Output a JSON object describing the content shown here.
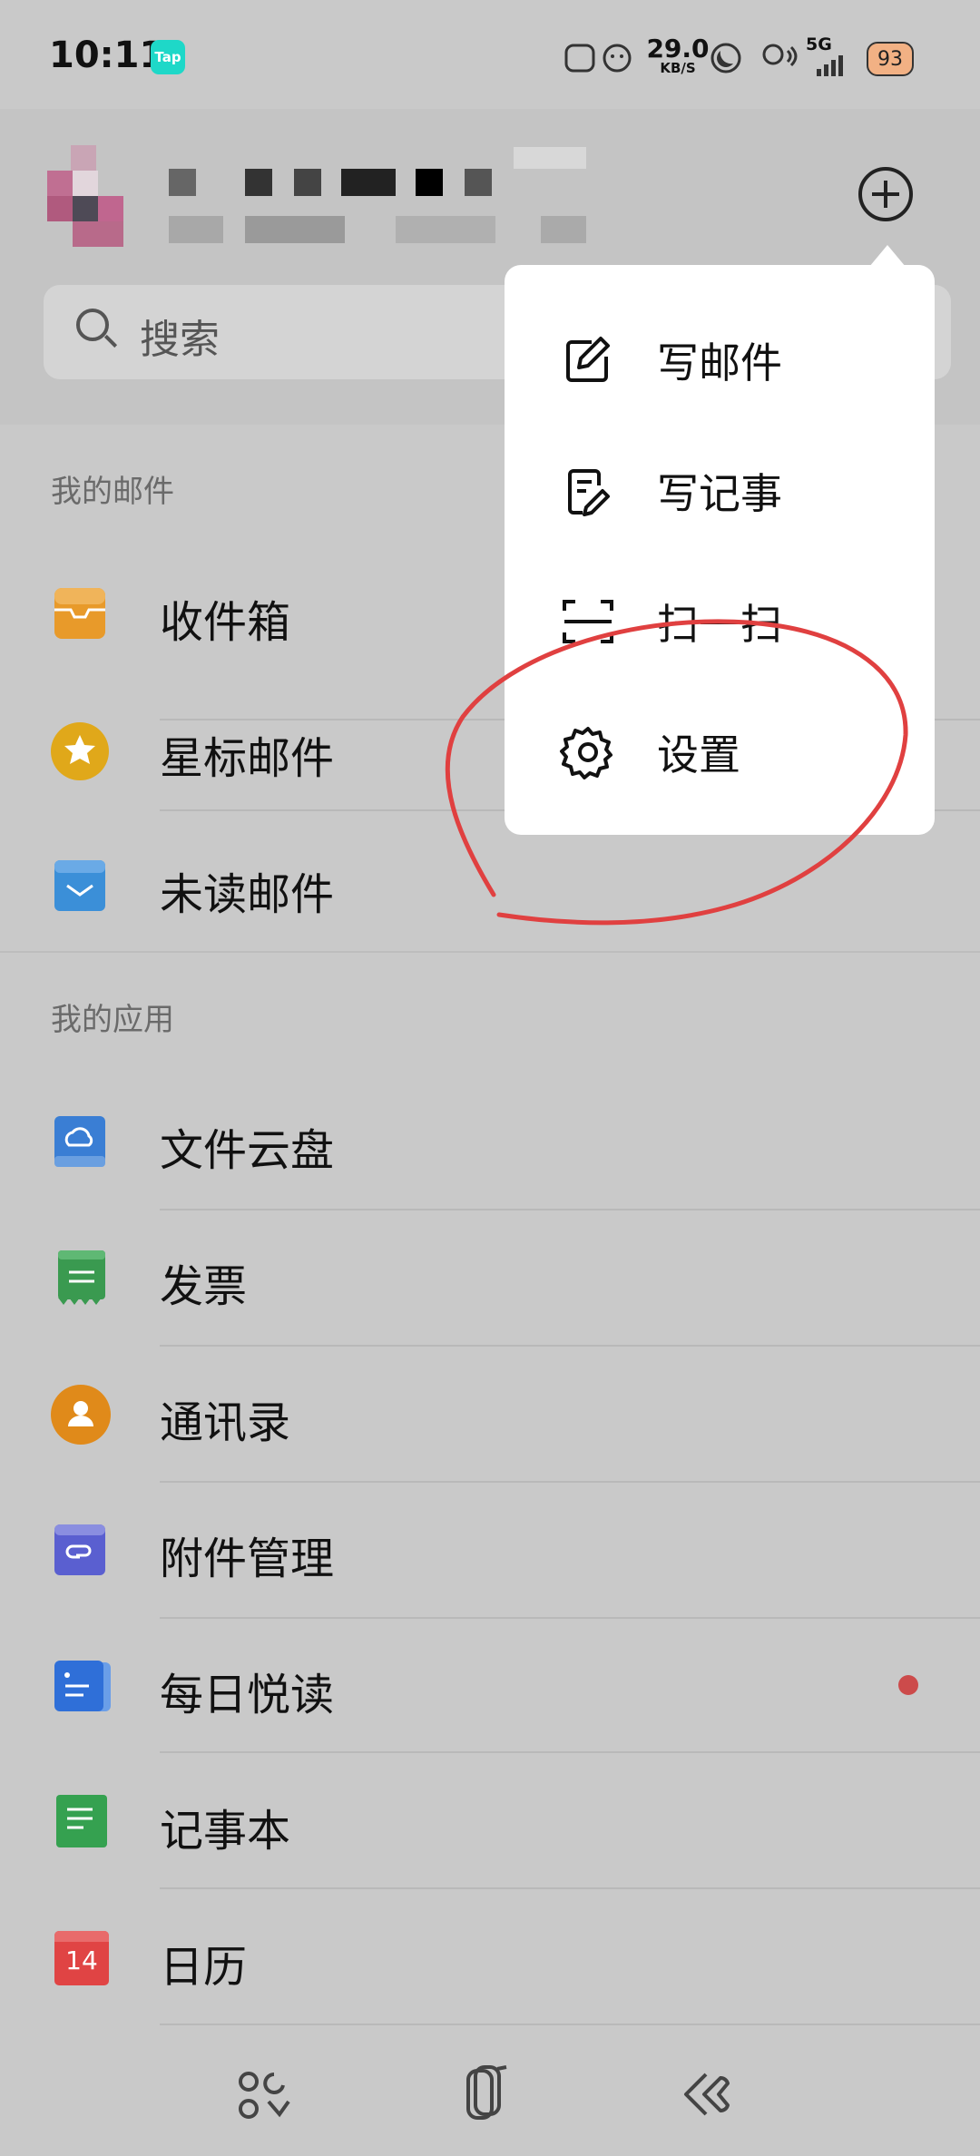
{
  "status_bar": {
    "time": "10:11",
    "app_badge": "Tap",
    "speed_value": "29.0",
    "speed_unit": "KB/S",
    "network": "5G",
    "battery": "93"
  },
  "search": {
    "placeholder": "搜索"
  },
  "sections": {
    "my_mail": {
      "title": "我的邮件",
      "items": [
        "收件箱",
        "星标邮件",
        "未读邮件"
      ]
    },
    "my_apps": {
      "title": "我的应用",
      "items": [
        "文件云盘",
        "发票",
        "通讯录",
        "附件管理",
        "每日悦读",
        "记事本",
        "日历"
      ]
    }
  },
  "calendar_day": "14",
  "popup_menu": {
    "items": [
      "写邮件",
      "写记事",
      "扫一扫",
      "设置"
    ]
  },
  "colors": {
    "inbox": "#e89a2a",
    "star": "#e0a81a",
    "unread": "#3b8fd8",
    "cloud": "#3a7ed4",
    "invoice": "#3a9a50",
    "contacts": "#e08a1a",
    "attachment": "#5a5fd0",
    "daily": "#2f6fd8",
    "notes": "#35a150",
    "calendar": "#e04444",
    "annotation": "#e04040"
  }
}
